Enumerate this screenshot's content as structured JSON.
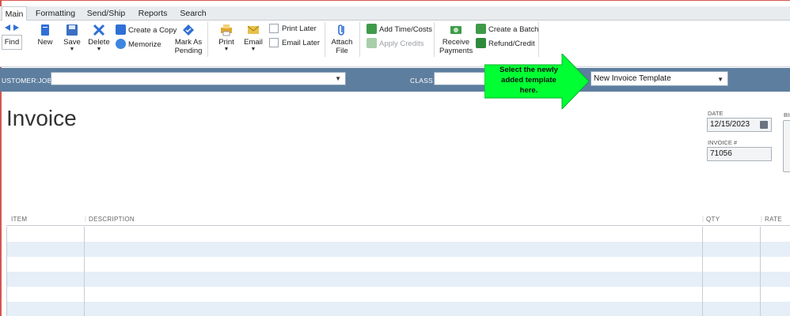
{
  "tabs": [
    "Main",
    "Formatting",
    "Send/Ship",
    "Reports",
    "Search"
  ],
  "ribbon": {
    "find": "Find",
    "new": "New",
    "save": "Save",
    "delete": "Delete",
    "create_copy": "Create a Copy",
    "memorize": "Memorize",
    "mark_as_pending_1": "Mark As",
    "mark_as_pending_2": "Pending",
    "print": "Print",
    "email": "Email",
    "print_later": "Print Later",
    "email_later": "Email Later",
    "attach_file_1": "Attach",
    "attach_file_2": "File",
    "add_time_costs": "Add Time/Costs",
    "apply_credits": "Apply Credits",
    "receive_payments_1": "Receive",
    "receive_payments_2": "Payments",
    "create_batch": "Create a Batch",
    "refund_credit": "Refund/Credit"
  },
  "custbar": {
    "customer_job_label": "USTOMER:JOB",
    "customer_job_value": "",
    "class_label": "CLASS",
    "class_value": "",
    "template_value": "New Invoice Template"
  },
  "callout": {
    "line1": "Select the newly",
    "line2": "added template",
    "line3": "here."
  },
  "form": {
    "title": "Invoice",
    "date_label": "DATE",
    "date_value": "12/15/2023",
    "invoice_no_label": "INVOICE #",
    "invoice_no_value": "71056",
    "bill_label": "BIL"
  },
  "table": {
    "columns": [
      "ITEM",
      "DESCRIPTION",
      "QTY",
      "RATE"
    ]
  },
  "colors": {
    "bar": "#5d7e9f",
    "arrow": "#00ff33",
    "row_alt": "#e6eef8"
  }
}
